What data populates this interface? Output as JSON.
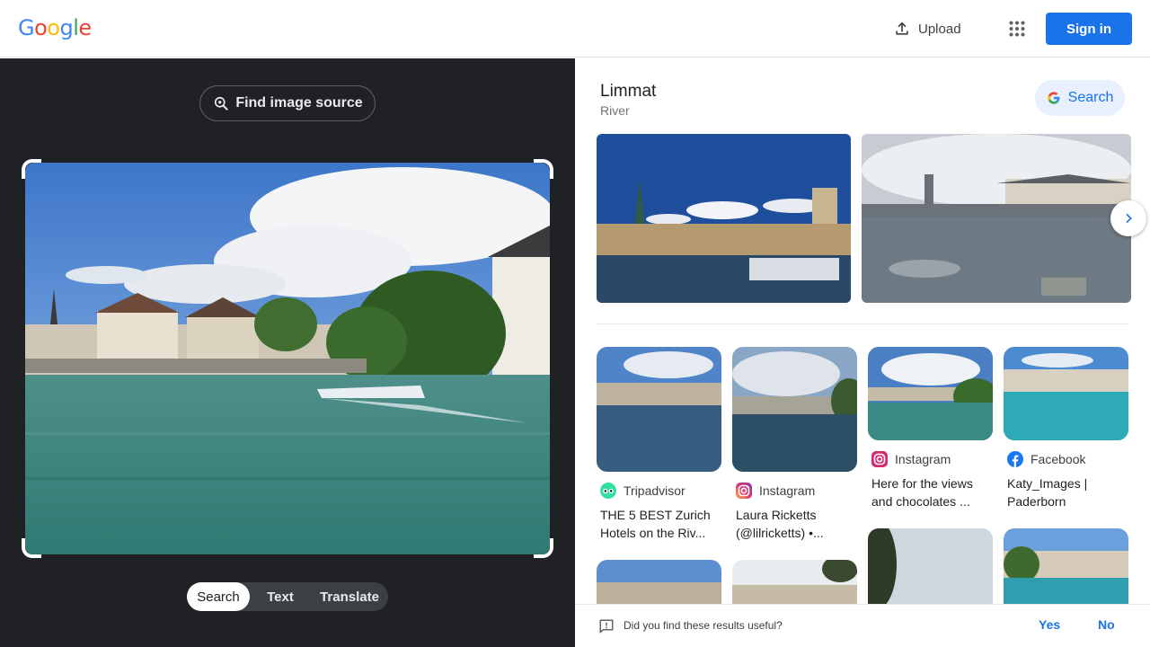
{
  "header": {
    "logo_letters": [
      "G",
      "o",
      "o",
      "g",
      "l",
      "e"
    ],
    "logo_colors": [
      "#4285F4",
      "#EA4335",
      "#FBBC05",
      "#4285F4",
      "#34A853",
      "#EA4335"
    ],
    "upload_label": "Upload",
    "signin_label": "Sign in"
  },
  "left": {
    "find_source_label": "Find image source",
    "mode_tabs": [
      "Search",
      "Text",
      "Translate"
    ],
    "active_mode": "Search"
  },
  "knowledge": {
    "title": "Limmat",
    "subtitle": "River",
    "search_label": "Search"
  },
  "results": [
    {
      "source": "Tripadvisor",
      "source_icon": "tripadvisor-icon",
      "title": "THE 5 BEST Zurich Hotels on the Riv..."
    },
    {
      "source": "Instagram",
      "source_icon": "instagram-icon",
      "title": "Laura Ricketts (@lilricketts) •..."
    },
    {
      "source": "Instagram",
      "source_icon": "instagram-icon",
      "title": "Here for the views and chocolates ..."
    },
    {
      "source": "Facebook",
      "source_icon": "facebook-icon",
      "title": "Katy_Images | Paderborn"
    }
  ],
  "feedback": {
    "question": "Did you find these results useful?",
    "yes": "Yes",
    "no": "No"
  },
  "colors": {
    "accent": "#1a73e8",
    "dark_pane": "#202124"
  }
}
